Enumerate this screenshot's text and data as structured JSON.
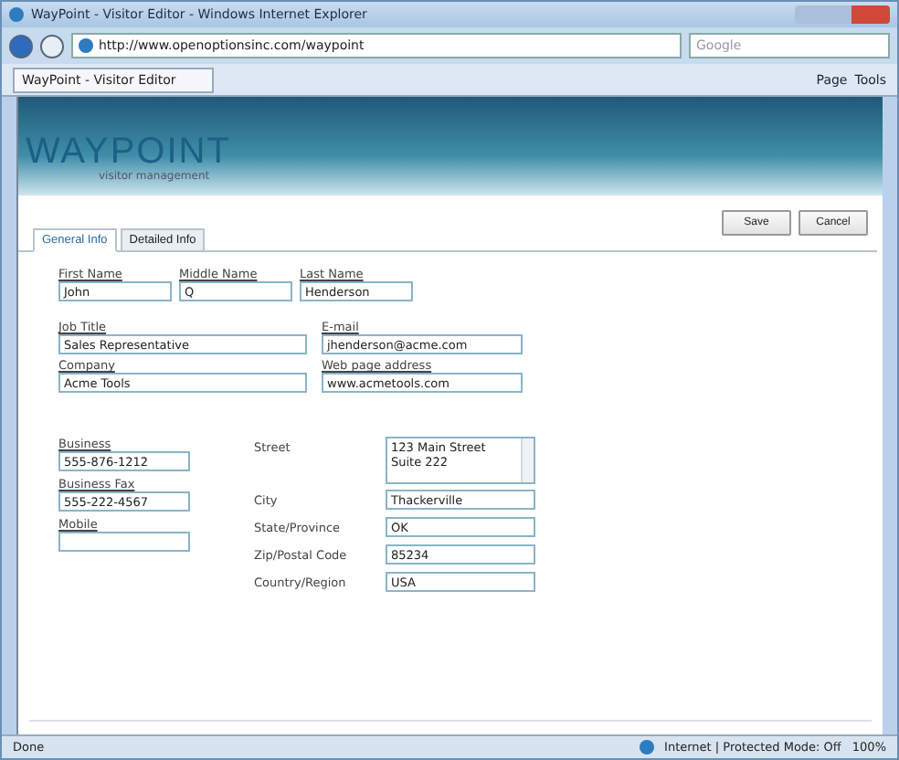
{
  "window": {
    "title": "WayPoint - Visitor Editor - Windows Internet Explorer"
  },
  "browser": {
    "address": "http://www.openoptionsinc.com/waypoint",
    "search_placeholder": "Google",
    "tab": "WayPoint - Visitor Editor",
    "commands": [
      "Page",
      "Tools"
    ]
  },
  "header": {
    "logo": "WAYPOINT",
    "subtitle": "visitor management"
  },
  "actions": [
    "Save",
    "Cancel"
  ],
  "tabs": [
    {
      "label": "General Info",
      "selected": true
    },
    {
      "label": "Detailed Info",
      "selected": false
    }
  ],
  "name_fields": [
    {
      "label": "First Name",
      "value": "John"
    },
    {
      "label": "Middle Name",
      "value": "Q"
    },
    {
      "label": "Last Name",
      "value": "Henderson"
    }
  ],
  "contact_fields": [
    {
      "label": "Job Title",
      "value": "Sales Representative"
    },
    {
      "label": "E-mail",
      "value": "jhenderson@acme.com"
    },
    {
      "label": "Company",
      "value": "Acme Tools"
    },
    {
      "label": "Web page address",
      "value": "www.acmetools.com"
    }
  ],
  "phone_fields": [
    {
      "label": "Business",
      "value": "555-876-1212"
    },
    {
      "label": "Business Fax",
      "value": "555-222-4567"
    },
    {
      "label": "Mobile"
    }
  ],
  "address_fields": [
    {
      "kind": "multiline",
      "label": "Street",
      "lines": [
        "123 Main Street",
        "Suite 222"
      ]
    },
    {
      "kind": "text",
      "label": "City",
      "value": "Thackerville"
    },
    {
      "kind": "text",
      "label": "State/Province",
      "value": "OK"
    },
    {
      "kind": "text",
      "label": "Zip/Postal Code",
      "value": "85234"
    },
    {
      "kind": "text",
      "label": "Country/Region",
      "value": "USA"
    }
  ],
  "status_bar": {
    "status": "Done",
    "zone": "Internet | Protected Mode: Off",
    "zoom": "100%"
  }
}
